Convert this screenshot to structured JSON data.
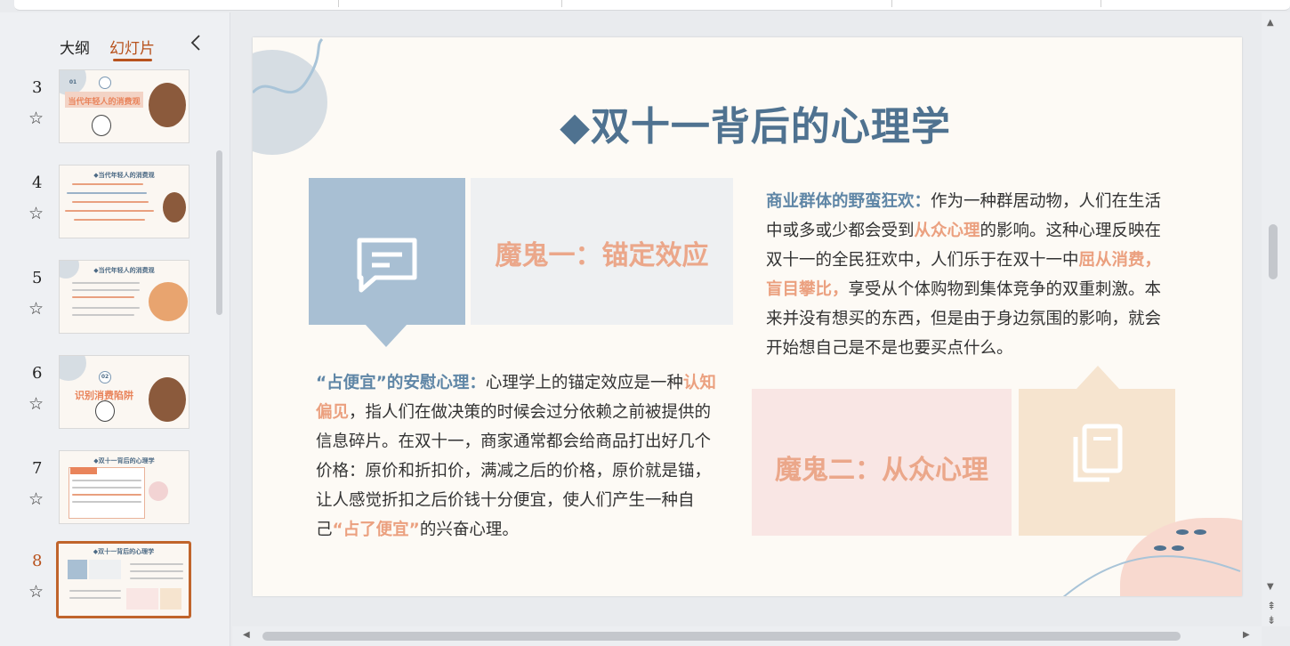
{
  "left_panel": {
    "tab_outline": "大纲",
    "tab_slides": "幻灯片",
    "collapse_icon": "chevron-left-icon",
    "thumbnails": [
      {
        "number": "3",
        "title": "当代年轻人的消费观",
        "badge": "01"
      },
      {
        "number": "4",
        "title": "◆当代年轻人的消费观"
      },
      {
        "number": "5",
        "title": "◆当代年轻人的消费观"
      },
      {
        "number": "6",
        "title": "识别消费陷阱",
        "badge": "02"
      },
      {
        "number": "7",
        "title": "◆双十一背后的心理学"
      },
      {
        "number": "8",
        "title": "◆双十一背后的心理学"
      }
    ]
  },
  "slide": {
    "title": "◆双十一背后的心理学",
    "demon1_label": "魔鬼一：锚定效应",
    "demon1_icon": "comment-icon",
    "para1_lead": "“占便宜”的安慰心理：",
    "para1_a": "心理学上的锚定效应是一种",
    "para1_hl1": "认知偏见",
    "para1_b": "，指人们在做决策的时候会过分依赖之前被提供的信息碎片。在双十一，商家通常都会给商品打出好几个价格：原价和折扣价，满减之后的价格，原价就是锚，让人感觉折扣之后价钱十分便宜，使人们产生一种自己",
    "para1_hl2": "“占了便宜”",
    "para1_c": "的兴奋心理。",
    "para2_lead": "商业群体的野蛮狂欢：",
    "para2_a": "作为一种群居动物，人们在生活中或多或少都会受到",
    "para2_hl1": "从众心理",
    "para2_b": "的影响。这种心理反映在双十一的全民狂欢中，人们乐于在双十一中",
    "para2_hl2": "屈从消费，盲目攀比，",
    "para2_c": "享受从个体购物到集体竞争的双重刺激。本来并没有想买的东西，但是由于身边氛围的影响，就会开始想自己是不是也要买点什么。",
    "demon2_label": "魔鬼二：从众心理",
    "demon2_icon": "copy-icon"
  },
  "colors": {
    "accent_tab": "#b8521d",
    "title_blue": "#4f7290",
    "highlight_pink": "#eba07f",
    "box_blue": "#a8bfd3",
    "box_beige": "#f6e4cf"
  }
}
